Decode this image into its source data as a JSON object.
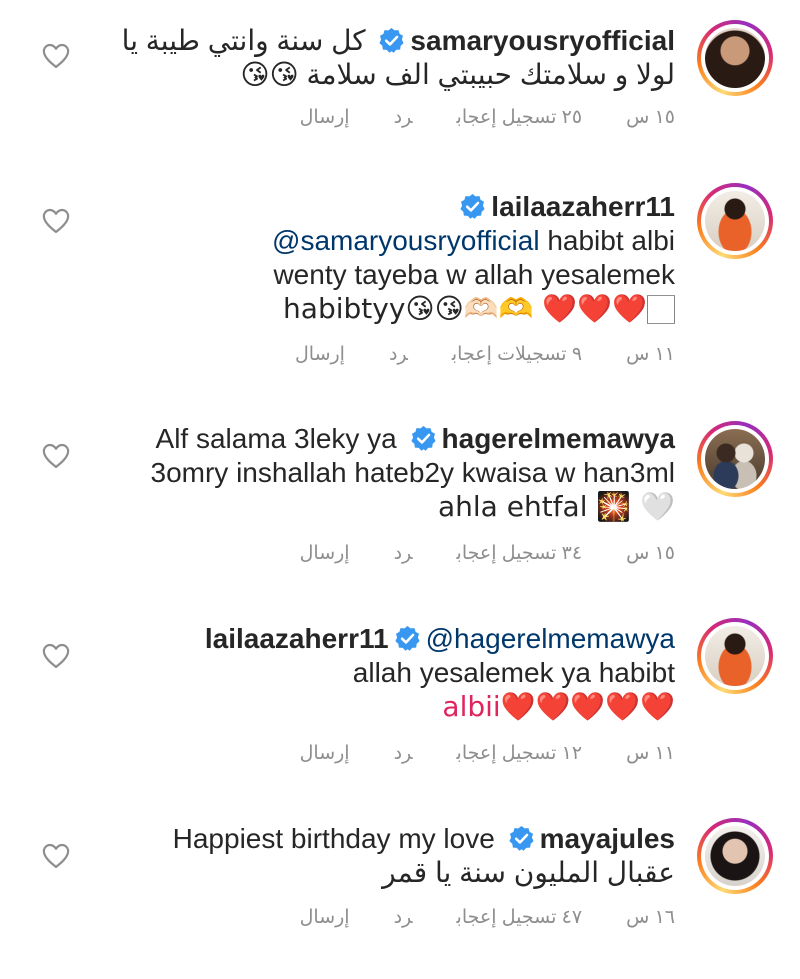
{
  "comments": [
    {
      "username": "samaryousryofficial",
      "lines": [
        "كل سنة وانتي طيبة يا",
        "لولا و سلامتك حبيبتي الف سلامة 😘😘"
      ],
      "time": "١٥ س",
      "likes": "٢٥ تسجيل إعجاب",
      "reply": "رد",
      "send": "إرسال"
    },
    {
      "username": "lailaazaherr11",
      "mention": "@samaryousryofficial",
      "lines": [
        "habibt albi",
        "wenty tayeba w allah yesalemek",
        "habibtyy😘😘🫶🏻🫶 ❤️❤️❤️🏻"
      ],
      "time": "١١ س",
      "likes": "٩ تسجيلات إعجاب",
      "reply": "رد",
      "send": "إرسال"
    },
    {
      "username": "hagerelmemawya",
      "lines": [
        "Alf salama 3leky ya",
        "3omry inshallah hateb2y kwaisa w han3ml",
        "ahla ehtfal 🎇 🤍"
      ],
      "time": "١٥ س",
      "likes": "٣٤ تسجيل إعجاب",
      "reply": "رد",
      "send": "إرسال"
    },
    {
      "username": "lailaazaherr11",
      "mention": "@hagerelmemawya",
      "lines": [
        "allah yesalemek ya habibt",
        "albii❤️❤️❤️❤️❤️"
      ],
      "time": "١١ س",
      "likes": "١٢ تسجيل إعجاب",
      "reply": "رد",
      "send": "إرسال"
    },
    {
      "username": "mayajules",
      "lines": [
        "Happiest birthday my love",
        "عقبال المليون سنة يا قمر"
      ],
      "time": "١٦ س",
      "likes": "٤٧ تسجيل إعجاب",
      "reply": "رد",
      "send": "إرسال"
    }
  ],
  "colors": {
    "verified": "#3897f0",
    "mention": "#00376b",
    "meta": "#8e8e8e",
    "ring": "#d62976"
  },
  "icons": [
    "verified-badge-icon",
    "heart-outline-icon"
  ]
}
